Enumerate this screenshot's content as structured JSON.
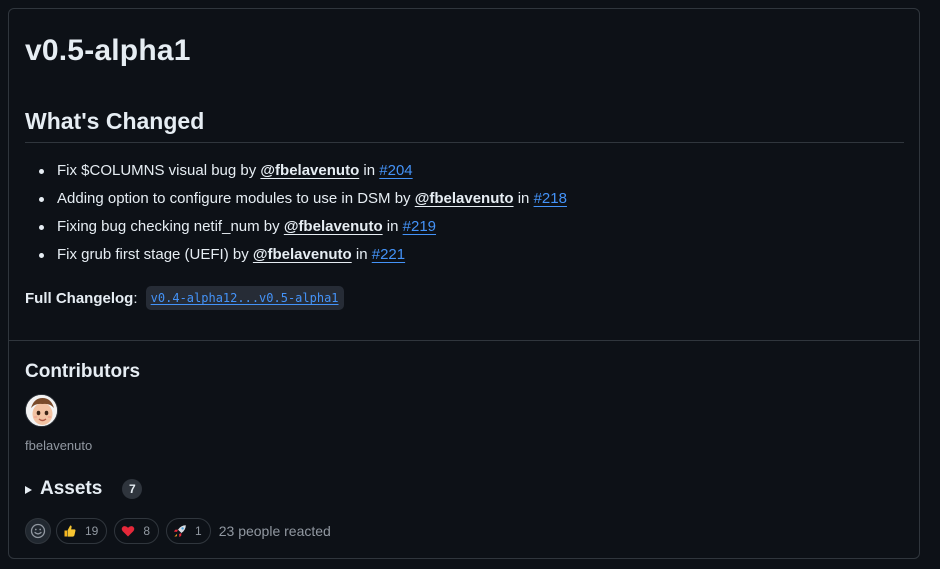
{
  "release": {
    "title": "v0.5-alpha1"
  },
  "changes_section": {
    "heading": "What's Changed",
    "items": [
      {
        "text": "Fix $COLUMNS visual bug",
        "by": "by",
        "author": "@fbelavenuto",
        "in": "in",
        "pr": "#204"
      },
      {
        "text": "Adding option to configure modules to use in DSM",
        "by": "by",
        "author": "@fbelavenuto",
        "in": "in",
        "pr": "#218"
      },
      {
        "text": "Fixing bug checking netif_num",
        "by": "by",
        "author": "@fbelavenuto",
        "in": "in",
        "pr": "#219"
      },
      {
        "text": "Fix grub first stage (UEFI)",
        "by": "by",
        "author": "@fbelavenuto",
        "in": "in",
        "pr": "#221"
      }
    ]
  },
  "changelog": {
    "label": "Full Changelog",
    "colon": ":",
    "range": "v0.4-alpha12...v0.5-alpha1"
  },
  "contributors": {
    "heading": "Contributors",
    "users": [
      {
        "name": "fbelavenuto"
      }
    ]
  },
  "assets": {
    "label": "Assets",
    "count": "7"
  },
  "reactions": {
    "items": [
      {
        "icon": "thumbs-up-icon",
        "count": "19"
      },
      {
        "icon": "heart-icon",
        "count": "8"
      },
      {
        "icon": "rocket-icon",
        "count": "1"
      }
    ],
    "summary": "23 people reacted"
  },
  "colors": {
    "background": "#0d1117",
    "border": "#30363d",
    "text": "#e6edf3",
    "muted": "#9198a1",
    "link": "#4493f8"
  }
}
